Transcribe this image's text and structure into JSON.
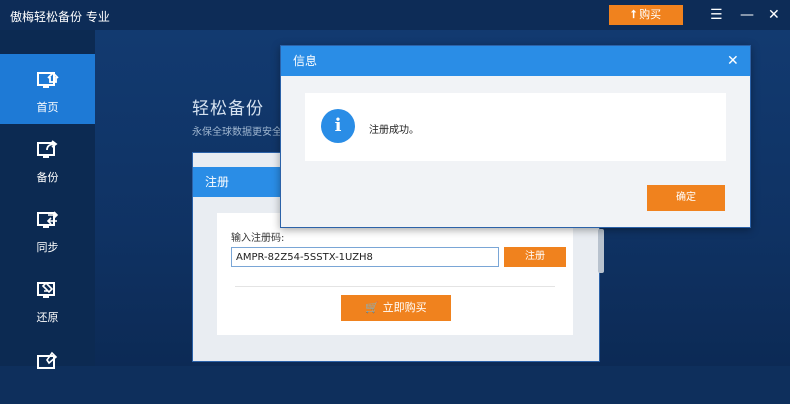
{
  "app": {
    "title": "傲梅轻松备份 专业",
    "buy_label": "购买"
  },
  "sidebar": {
    "items": [
      {
        "label": "首页",
        "icon": "home-monitor-icon",
        "active": true
      },
      {
        "label": "备份",
        "icon": "backup-monitor-icon",
        "active": false
      },
      {
        "label": "同步",
        "icon": "sync-monitor-icon",
        "active": false
      },
      {
        "label": "还原",
        "icon": "restore-monitor-icon",
        "active": false
      },
      {
        "label": "",
        "icon": "tools-monitor-icon",
        "active": false
      }
    ]
  },
  "main": {
    "title": "轻松备份",
    "subtitle": "永保全球数据更安全"
  },
  "register_dialog": {
    "title": "注册",
    "code_label": "输入注册码:",
    "code_value": "AMPR-82Z54-5SSTX-1UZH8",
    "register_button": "注册",
    "buy_now_button": "立即购买"
  },
  "info_dialog": {
    "title": "信息",
    "message": "注册成功。",
    "ok_button": "确定"
  },
  "colors": {
    "accent_orange": "#f0821e",
    "header_blue": "#2a8de6",
    "sidebar_active": "#1e7ad6",
    "background_dark": "#0e2f5c"
  }
}
